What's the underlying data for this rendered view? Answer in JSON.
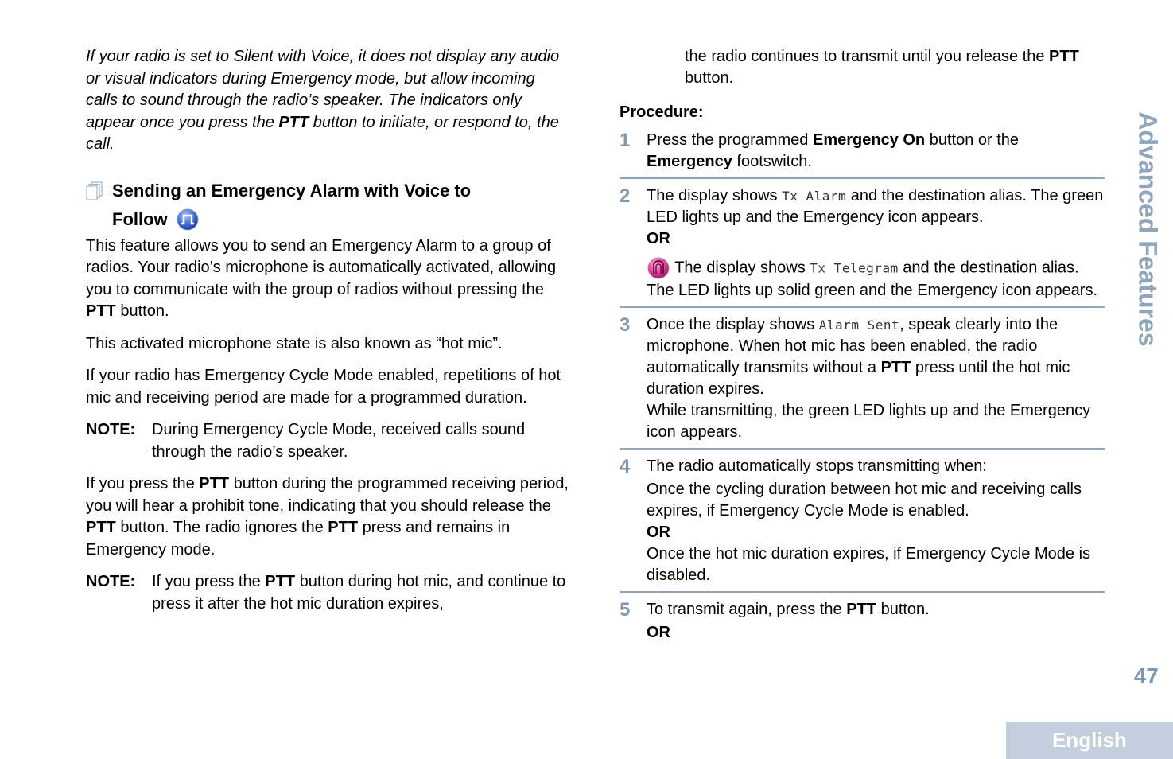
{
  "left_column": {
    "intro_italic": "If your radio is set to Silent with Voice, it does not display any audio or visual indicators during Emergency mode, but allow incoming calls to sound through the radio’s speaker. The indicators only appear once you press the ",
    "intro_italic_bold": "PTT",
    "intro_italic_end": " button to initiate, or respond to, the call.",
    "heading_line1": "Sending an Emergency Alarm with Voice to",
    "heading_line2": "Follow",
    "para1_a": "This feature allows you to send an Emergency Alarm to a group of radios. Your radio’s microphone is automatically activated, allowing you to communicate with the group of radios without pressing the ",
    "para1_bold": "PTT",
    "para1_b": " button.",
    "para2": "This activated microphone state is also known as “hot mic”.",
    "para3": "If your radio has Emergency Cycle Mode enabled, repetitions of hot mic and receiving period are made for a programmed duration.",
    "note1_label": "NOTE:",
    "note1_text": "During Emergency Cycle Mode, received calls sound through the radio’s speaker.",
    "para4_a": "If you press the ",
    "para4_b1": "PTT",
    "para4_c": " button during the programmed receiving period, you will hear a prohibit tone, indicating that you should release the ",
    "para4_b2": "PTT",
    "para4_d": " button. The radio ignores the ",
    "para4_b3": "PTT",
    "para4_e": " press and remains in Emergency mode.",
    "note2_label": "NOTE:",
    "note2_a": "If you press the ",
    "note2_bold": "PTT",
    "note2_b": " button during hot mic, and continue to press it after the hot mic duration expires,"
  },
  "right_column": {
    "cont_a": "the radio continues to transmit until you release the ",
    "cont_bold": "PTT",
    "cont_b": " button.",
    "procedure_label": "Procedure:",
    "steps": [
      {
        "num": "1",
        "a": "Press the programmed ",
        "b1": "Emergency On",
        "c": " button or the ",
        "b2": "Emergency",
        "d": " footswitch."
      },
      {
        "num": "2",
        "a": "The display shows ",
        "mono": "Tx Alarm",
        "b": " and the destination alias. The green LED lights up and the Emergency icon appears.",
        "or": "OR",
        "tele_a": " The display shows ",
        "tele_mono": "Tx Telegram",
        "tele_b": " and the destination alias. The LED lights up solid green and the Emergency icon appears."
      },
      {
        "num": "3",
        "a": "Once the display shows ",
        "mono": "Alarm Sent",
        "b": ", speak clearly into the microphone. When hot mic has been enabled, the radio automatically transmits without a ",
        "bold": "PTT",
        "c": " press until the hot mic duration expires.",
        "d": "While transmitting, the green LED lights up and the Emergency icon appears."
      },
      {
        "num": "4",
        "a": "The radio automatically stops transmitting when:",
        "b": "Once the cycling duration between hot mic and receiving calls expires, if Emergency Cycle Mode is enabled.",
        "or": "OR",
        "c": "Once the hot mic duration expires, if Emergency Cycle Mode is disabled."
      },
      {
        "num": "5",
        "a": "To transmit again, press the ",
        "bold": "PTT",
        "b": " button.",
        "or": "OR"
      }
    ]
  },
  "side_tab": "Advanced Features",
  "page_number": "47",
  "language_tab": "English",
  "icons": {
    "heading_icon": "document-stack-icon",
    "follow_icon": "voice-to-follow-icon",
    "telegram_icon": "emergency-telegram-icon"
  },
  "colors": {
    "accent": "#8fa6bd",
    "step_number": "#7f97b0",
    "language_tab_bg": "#c3cfdc"
  }
}
